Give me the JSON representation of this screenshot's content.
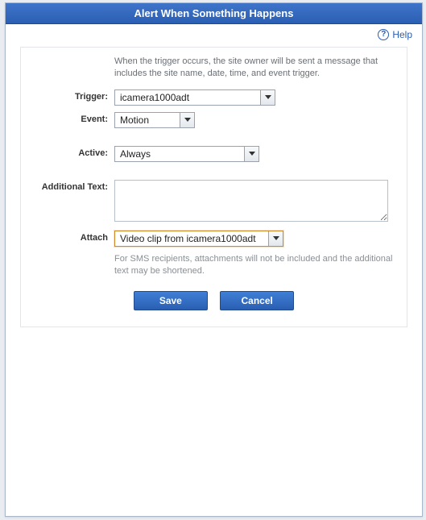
{
  "title": "Alert When Something Happens",
  "help": {
    "label": "Help"
  },
  "description": "When the trigger occurs, the site owner will be sent a message that includes the site name, date, time, and event trigger.",
  "labels": {
    "trigger": "Trigger:",
    "event": "Event:",
    "active": "Active:",
    "additional_text": "Additional Text:",
    "attach": "Attach"
  },
  "fields": {
    "trigger": {
      "value": "icamera1000adt"
    },
    "event": {
      "value": "Motion"
    },
    "active": {
      "value": "Always"
    },
    "additional_text": {
      "value": ""
    },
    "attach": {
      "value": "Video clip from icamera1000adt"
    }
  },
  "hint": "For SMS recipients, attachments will not be included and the additional text may be shortened.",
  "buttons": {
    "save": "Save",
    "cancel": "Cancel"
  }
}
